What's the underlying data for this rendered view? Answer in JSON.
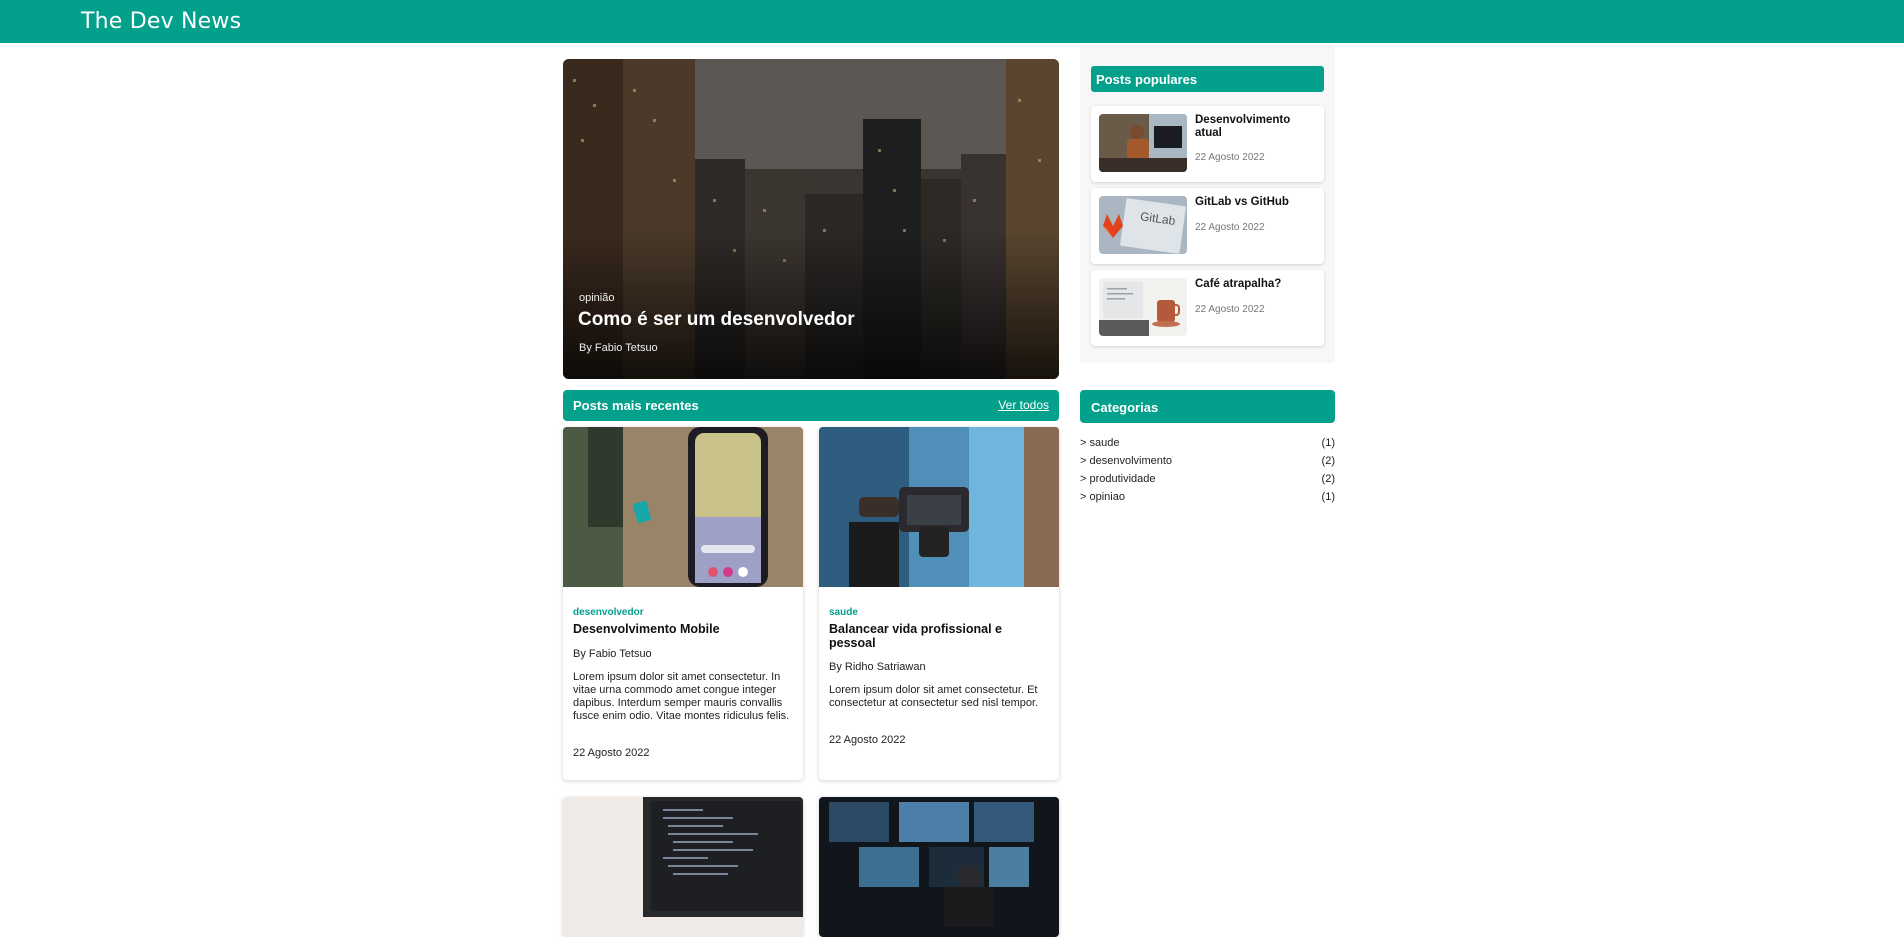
{
  "header": {
    "site_title": "The Dev News"
  },
  "hero": {
    "tag": "opinião",
    "title": "Como é ser um desenvolvedor",
    "author": "By Fabio Tetsuo"
  },
  "recent": {
    "title": "Posts mais recentes",
    "link": "Ver todos",
    "posts": [
      {
        "tag": "desenvolvedor",
        "title": "Desenvolvimento Mobile",
        "author": "By Fabio Tetsuo",
        "text": "Lorem ipsum dolor sit amet consectetur. In vitae urna commodo amet congue integer dapibus. Interdum semper mauris convallis fusce enim odio. Vitae montes ridiculus felis.",
        "date": "22 Agosto 2022"
      },
      {
        "tag": "saude",
        "title": "Balancear vida profissional e pessoal",
        "author": "By Ridho Satriawan",
        "text": "Lorem ipsum dolor sit amet consectetur. Et consectetur at consectetur sed nisl tempor.",
        "date": "22 Agosto 2022"
      }
    ]
  },
  "popular": {
    "title": "Posts populares",
    "items": [
      {
        "title": "Desenvolvimento atual",
        "date": "22 Agosto 2022"
      },
      {
        "title": "GitLab vs GitHub",
        "date": "22 Agosto 2022",
        "thumb_text": "GitLab"
      },
      {
        "title": "Café atrapalha?",
        "date": "22 Agosto 2022"
      }
    ]
  },
  "categories": {
    "title": "Categorias",
    "items": [
      {
        "name": "> saude",
        "count": "(1)"
      },
      {
        "name": "> desenvolvimento",
        "count": "(2)"
      },
      {
        "name": "> produtividade",
        "count": "(2)"
      },
      {
        "name": "> opiniao",
        "count": "(1)"
      }
    ]
  },
  "colors": {
    "accent": "#03a08c"
  }
}
